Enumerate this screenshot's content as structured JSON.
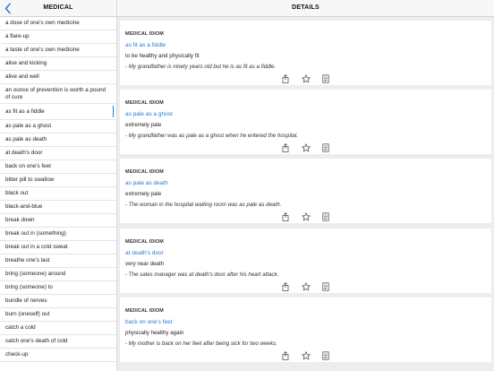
{
  "left_pane": {
    "title": "MEDICAL",
    "back_icon": "chevron-left-icon",
    "items": [
      {
        "label": "a dose of one's own medicine",
        "selected": false
      },
      {
        "label": "a flare-up",
        "selected": false
      },
      {
        "label": "a taste of one's own medicine",
        "selected": false
      },
      {
        "label": "alive and kicking",
        "selected": false
      },
      {
        "label": "alive and well",
        "selected": false
      },
      {
        "label": "an ounce of prevention is worth a pound of cure",
        "selected": false
      },
      {
        "label": "as fit as a fiddle",
        "selected": true
      },
      {
        "label": "as pale as a ghost",
        "selected": false
      },
      {
        "label": "as pale as death",
        "selected": false
      },
      {
        "label": "at death's door",
        "selected": false
      },
      {
        "label": "back on one's feet",
        "selected": false
      },
      {
        "label": "bitter pill to swallow",
        "selected": false
      },
      {
        "label": "black out",
        "selected": false
      },
      {
        "label": "black-and-blue",
        "selected": false
      },
      {
        "label": "break down",
        "selected": false
      },
      {
        "label": "break out in (something)",
        "selected": false
      },
      {
        "label": "break out in a cold sweat",
        "selected": false
      },
      {
        "label": "breathe one's last",
        "selected": false
      },
      {
        "label": "bring (someone) around",
        "selected": false
      },
      {
        "label": "bring (someone) to",
        "selected": false
      },
      {
        "label": "bundle of nerves",
        "selected": false
      },
      {
        "label": "burn (oneself) out",
        "selected": false
      },
      {
        "label": "catch a cold",
        "selected": false
      },
      {
        "label": "catch one's death of cold",
        "selected": false
      },
      {
        "label": "check-up",
        "selected": false
      }
    ]
  },
  "right_pane": {
    "title": "DETAILS",
    "cards": [
      {
        "type": "MEDICAL IDIOM",
        "term": "as fit as a fiddle",
        "definition": "to be healthy and physically fit",
        "example": "- My grandfather is ninety years old but he is as fit as a fiddle."
      },
      {
        "type": "MEDICAL IDIOM",
        "term": "as pale as a ghost",
        "definition": "extremely pale",
        "example": "- My grandfather was as pale as a ghost when he entered the hospital."
      },
      {
        "type": "MEDICAL IDIOM",
        "term": "as pale as death",
        "definition": "extremely pale",
        "example": "- The woman in the hospital waiting room was as pale as death."
      },
      {
        "type": "MEDICAL IDIOM",
        "term": "at death's door",
        "definition": "very near death",
        "example": "- The sales manager was at death's door after his heart attack."
      },
      {
        "type": "MEDICAL IDIOM",
        "term": "back on one's feet",
        "definition": "physically healthy again",
        "example": "- My mother is back on her feet after being sick for two weeks."
      }
    ],
    "card_action_icons": [
      "share-icon",
      "star-icon",
      "notes-icon"
    ]
  },
  "colors": {
    "accent": "#2a7bd3",
    "pane_background": "#ededef",
    "header_background": "#f7f7f8"
  }
}
